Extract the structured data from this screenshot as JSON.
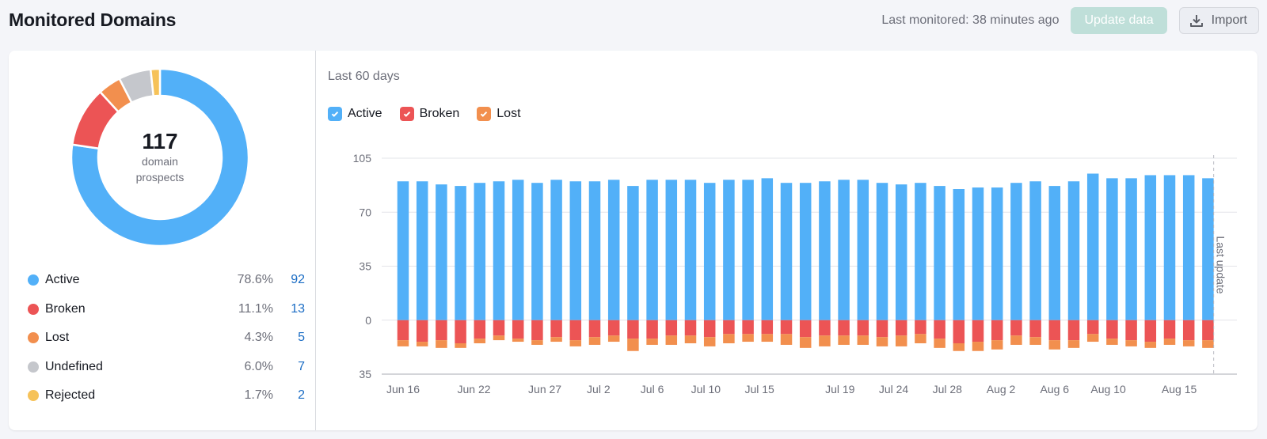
{
  "header": {
    "title": "Monitored Domains",
    "last_monitored": "Last monitored: 38 minutes ago",
    "update_label": "Update data",
    "import_label": "Import",
    "import_icon": "download-icon"
  },
  "summary": {
    "total": "117",
    "caption": "domain prospects",
    "items": [
      {
        "label": "Active",
        "percent": "78.6%",
        "count": "92",
        "value": 92,
        "color": "#52b0f8"
      },
      {
        "label": "Broken",
        "percent": "11.1%",
        "count": "13",
        "value": 13,
        "color": "#ec5455"
      },
      {
        "label": "Lost",
        "percent": "4.3%",
        "count": "5",
        "value": 5,
        "color": "#f28f4e"
      },
      {
        "label": "Undefined",
        "percent": "6.0%",
        "count": "7",
        "value": 7,
        "color": "#c5c7cc"
      },
      {
        "label": "Rejected",
        "percent": "1.7%",
        "count": "2",
        "value": 2,
        "color": "#f6c259"
      }
    ]
  },
  "chart_panel": {
    "subtitle": "Last 60 days",
    "legend": [
      {
        "label": "Active",
        "color": "#52b0f8",
        "checked": true
      },
      {
        "label": "Broken",
        "color": "#ec5455",
        "checked": true
      },
      {
        "label": "Lost",
        "color": "#f28f4e",
        "checked": true
      }
    ],
    "marker_label": "Last update"
  },
  "chart_data": {
    "type": "bar",
    "stacked": true,
    "title": "Last 60 days",
    "ylim": [
      -35,
      105
    ],
    "yticks": [
      105,
      70,
      35,
      0,
      -35
    ],
    "ytick_labels": [
      "105",
      "70",
      "35",
      "0",
      "35"
    ],
    "grid": true,
    "legend_position": "top-left",
    "xtick_labels": [
      {
        "index": 0,
        "label": "Jun 16"
      },
      {
        "index": 3.7,
        "label": "Jun 22"
      },
      {
        "index": 7.4,
        "label": "Jun 27"
      },
      {
        "index": 10.2,
        "label": "Jul 2"
      },
      {
        "index": 13,
        "label": "Jul 6"
      },
      {
        "index": 15.8,
        "label": "Jul 10"
      },
      {
        "index": 18.6,
        "label": "Jul 15"
      },
      {
        "index": 22.8,
        "label": "Jul 19"
      },
      {
        "index": 25.6,
        "label": "Jul 24"
      },
      {
        "index": 28.4,
        "label": "Jul 28"
      },
      {
        "index": 31.2,
        "label": "Aug 2"
      },
      {
        "index": 34,
        "label": "Aug 6"
      },
      {
        "index": 36.8,
        "label": "Aug 10"
      },
      {
        "index": 40.5,
        "label": "Aug 15"
      }
    ],
    "marker_index": 42.3,
    "series": [
      {
        "name": "Active",
        "color": "#52b0f8",
        "values": [
          90,
          90,
          88,
          87,
          89,
          90,
          91,
          89,
          91,
          90,
          90,
          91,
          87,
          91,
          91,
          91,
          89,
          91,
          91,
          92,
          89,
          89,
          90,
          91,
          91,
          89,
          88,
          89,
          87,
          85,
          86,
          86,
          89,
          90,
          87,
          90,
          95,
          92,
          92,
          94,
          94,
          94,
          92
        ]
      },
      {
        "name": "Broken",
        "color": "#ec5455",
        "values": [
          -13,
          -14,
          -13,
          -15,
          -12,
          -10,
          -12,
          -13,
          -11,
          -13,
          -11,
          -10,
          -12,
          -12,
          -10,
          -10,
          -11,
          -9,
          -9,
          -9,
          -9,
          -11,
          -10,
          -10,
          -10,
          -11,
          -10,
          -9,
          -12,
          -15,
          -14,
          -13,
          -10,
          -11,
          -13,
          -13,
          -9,
          -12,
          -13,
          -14,
          -12,
          -13,
          -13
        ]
      },
      {
        "name": "Lost",
        "color": "#f28f4e",
        "values": [
          -4,
          -3,
          -5,
          -3,
          -3,
          -3,
          -2,
          -3,
          -3,
          -4,
          -5,
          -4,
          -8,
          -4,
          -6,
          -5,
          -6,
          -6,
          -5,
          -5,
          -7,
          -7,
          -7,
          -6,
          -6,
          -6,
          -7,
          -6,
          -6,
          -5,
          -6,
          -6,
          -6,
          -5,
          -6,
          -5,
          -5,
          -4,
          -4,
          -4,
          -4,
          -4,
          -5
        ]
      }
    ]
  }
}
